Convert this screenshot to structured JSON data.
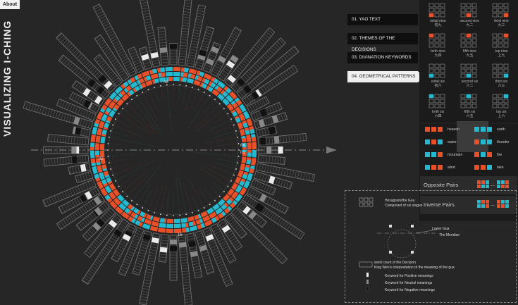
{
  "about": "About",
  "title": "VISUALIZING I-CHING",
  "wheel_labels": [
    "48",
    "64",
    "01",
    "32",
    "16"
  ],
  "menu": [
    {
      "label": "01. YAO TEXT",
      "active": false
    },
    {
      "label": "02. THEMES OF THE DECISIONS",
      "active": false
    },
    {
      "label": "03. DIVINATION KEYWORDS",
      "active": false
    },
    {
      "label": "04. GEOMETRICAL PATTERNS",
      "active": true
    }
  ],
  "yao_positions": [
    {
      "en": "initial nine",
      "zh": "初九"
    },
    {
      "en": "second nine",
      "zh": "九二"
    },
    {
      "en": "third nine",
      "zh": "九三"
    },
    {
      "en": "forth nine",
      "zh": "九四"
    },
    {
      "en": "fifth nine",
      "zh": "九五"
    },
    {
      "en": "top nine",
      "zh": "上九"
    },
    {
      "en": "initial six",
      "zh": "初六"
    },
    {
      "en": "second six",
      "zh": "六二"
    },
    {
      "en": "third six",
      "zh": "六三"
    },
    {
      "en": "forth six",
      "zh": "六四"
    },
    {
      "en": "fifth six",
      "zh": "六五"
    },
    {
      "en": "top six",
      "zh": "上六"
    }
  ],
  "trigrams": [
    {
      "name": "heaven",
      "colors": [
        "#e8502a",
        "#e8502a",
        "#e8502a"
      ]
    },
    {
      "name": "earth",
      "colors": [
        "#25b9cf",
        "#25b9cf",
        "#25b9cf"
      ]
    },
    {
      "name": "water",
      "colors": [
        "#25b9cf",
        "#e8502a",
        "#25b9cf"
      ]
    },
    {
      "name": "thunder",
      "colors": [
        "#e8502a",
        "#25b9cf",
        "#25b9cf"
      ]
    },
    {
      "name": "mountain",
      "colors": [
        "#25b9cf",
        "#25b9cf",
        "#e8502a"
      ]
    },
    {
      "name": "fire",
      "colors": [
        "#e8502a",
        "#25b9cf",
        "#e8502a"
      ]
    },
    {
      "name": "wind",
      "colors": [
        "#25b9cf",
        "#e8502a",
        "#e8502a"
      ]
    },
    {
      "name": "lake",
      "colors": [
        "#e8502a",
        "#e8502a",
        "#25b9cf"
      ]
    }
  ],
  "pairs": [
    {
      "label": "Opposite Pairs"
    },
    {
      "label": "Inverse Pairs"
    }
  ],
  "legend": {
    "hexagram_title": "Hexagram/the Gua",
    "hexagram_sub": "Composed of six stages",
    "lower_gua": "Lower Gua",
    "meridian": "The Meridian",
    "word_count": "word count of the Decision",
    "interpretation": "King Wen's interpretation of the meaning of the gua",
    "positive": "Keyword for Positive meanings",
    "neutral": "Keyword for Neutral meanings",
    "negative": "Keyword for Negative meanings"
  },
  "colors": {
    "yang": "#e8502a",
    "yin": "#25b9cf",
    "background": "#262626"
  }
}
